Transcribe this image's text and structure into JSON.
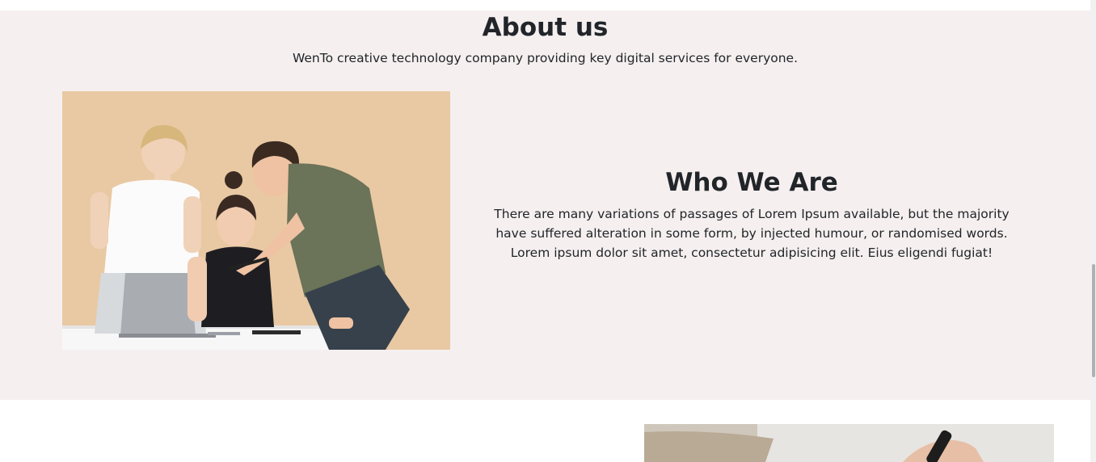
{
  "about": {
    "title": "About us",
    "subtitle": "WenTo creative technology company providing key digital services for everyone."
  },
  "who": {
    "title": "Who We Are",
    "text": "There are many variations of passages of Lorem Ipsum available, but the majority have suffered alteration in some form, by injected humour, or randomised words. Lorem ipsum dolor sit amet, consectetur adipisicing elit. Eius eligendi fugiat!"
  },
  "colors": {
    "section_bg": "#f5efef",
    "text": "#212529",
    "photo_bg": "#e9c9a3"
  }
}
